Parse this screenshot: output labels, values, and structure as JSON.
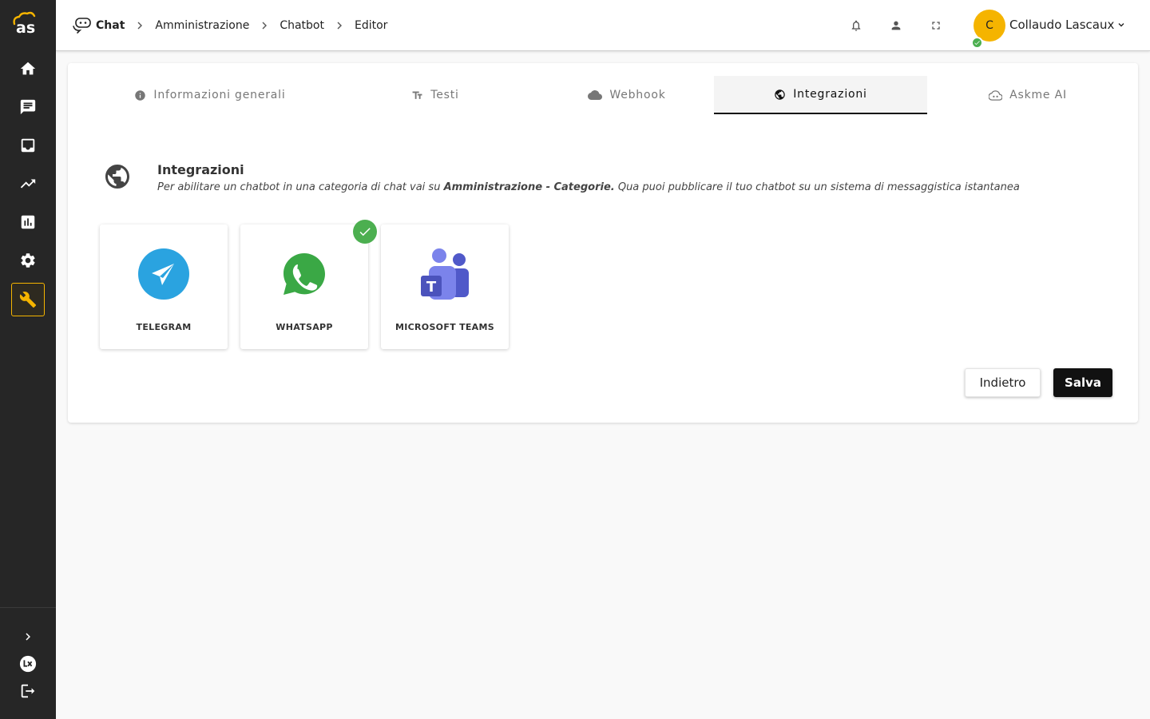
{
  "sidebar": {
    "logo_text": "as",
    "items": [
      {
        "icon": "home-icon"
      },
      {
        "icon": "chat-icon"
      },
      {
        "icon": "inbox-icon"
      },
      {
        "icon": "trending-icon"
      },
      {
        "icon": "bar-chart-icon"
      },
      {
        "icon": "gear-icon"
      },
      {
        "icon": "wrench-icon",
        "active": true
      }
    ],
    "bottom": [
      {
        "icon": "chevron-right-icon"
      },
      {
        "icon": "lx-icon"
      },
      {
        "icon": "logout-icon"
      }
    ],
    "accent_color": "#f5b400"
  },
  "header": {
    "breadcrumb": [
      "Chat",
      "Amministrazione",
      "Chatbot",
      "Editor"
    ],
    "user": {
      "initial": "C",
      "name": "Collaudo Lascaux",
      "avatar_color": "#f5b400",
      "status_color": "#4caf50"
    }
  },
  "tabs": [
    {
      "label": "Informazioni generali",
      "icon": "info-icon"
    },
    {
      "label": "Testi",
      "icon": "text-format-icon"
    },
    {
      "label": "Webhook",
      "icon": "cloud-icon"
    },
    {
      "label": "Integrazioni",
      "icon": "globe-icon",
      "active": true
    },
    {
      "label": "Askme AI",
      "icon": "ai-cloud-icon"
    }
  ],
  "section": {
    "title": "Integrazioni",
    "desc_before": "Per abilitare un chatbot in una categoria di chat vai su ",
    "desc_bold": "Amministrazione - Categorie.",
    "desc_after": " Qua puoi pubblicare il tuo chatbot su un sistema di messaggistica istantanea"
  },
  "integrations": [
    {
      "label": "TELEGRAM",
      "icon": "telegram-icon",
      "enabled": false
    },
    {
      "label": "WHATSAPP",
      "icon": "whatsapp-icon",
      "enabled": true
    },
    {
      "label": "MICROSOFT TEAMS",
      "icon": "teams-icon",
      "enabled": false
    }
  ],
  "actions": {
    "back_label": "Indietro",
    "save_label": "Salva"
  }
}
